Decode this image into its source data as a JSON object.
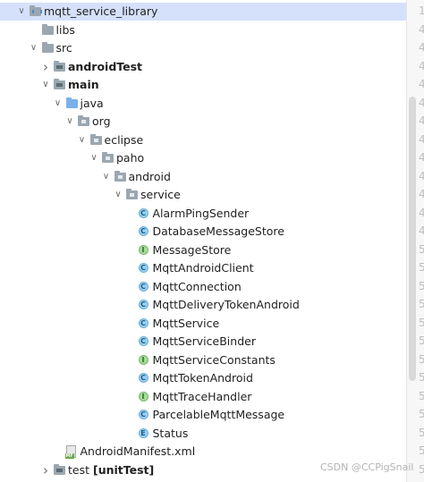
{
  "tree": [
    {
      "label": "mqtt_service_library",
      "suffix": "",
      "depth": 0,
      "arrow": "down",
      "icon": "module-folder-icon",
      "bold": false,
      "selected": true
    },
    {
      "label": "libs",
      "suffix": "",
      "depth": 1,
      "arrow": "none",
      "icon": "folder-icon",
      "bold": false,
      "selected": false
    },
    {
      "label": "src",
      "suffix": "",
      "depth": 1,
      "arrow": "down",
      "icon": "folder-icon",
      "bold": false,
      "selected": false
    },
    {
      "label": "androidTest",
      "suffix": "",
      "depth": 2,
      "arrow": "right",
      "icon": "source-set-folder-icon",
      "bold": true,
      "selected": false
    },
    {
      "label": "main",
      "suffix": "",
      "depth": 2,
      "arrow": "down",
      "icon": "source-set-folder-icon",
      "bold": true,
      "selected": false
    },
    {
      "label": "java",
      "suffix": "",
      "depth": 3,
      "arrow": "down",
      "icon": "source-root-folder-icon",
      "bold": false,
      "selected": false
    },
    {
      "label": "org",
      "suffix": "",
      "depth": 4,
      "arrow": "down",
      "icon": "package-folder-icon",
      "bold": false,
      "selected": false
    },
    {
      "label": "eclipse",
      "suffix": "",
      "depth": 5,
      "arrow": "down",
      "icon": "package-folder-icon",
      "bold": false,
      "selected": false
    },
    {
      "label": "paho",
      "suffix": "",
      "depth": 6,
      "arrow": "down",
      "icon": "package-folder-icon",
      "bold": false,
      "selected": false
    },
    {
      "label": "android",
      "suffix": "",
      "depth": 7,
      "arrow": "down",
      "icon": "package-folder-icon",
      "bold": false,
      "selected": false
    },
    {
      "label": "service",
      "suffix": "",
      "depth": 8,
      "arrow": "down",
      "icon": "package-folder-icon",
      "bold": false,
      "selected": false
    },
    {
      "label": "AlarmPingSender",
      "suffix": "",
      "depth": 9,
      "arrow": "none",
      "icon": "class-icon",
      "bold": false,
      "selected": false
    },
    {
      "label": "DatabaseMessageStore",
      "suffix": "",
      "depth": 9,
      "arrow": "none",
      "icon": "class-icon",
      "bold": false,
      "selected": false
    },
    {
      "label": "MessageStore",
      "suffix": "",
      "depth": 9,
      "arrow": "none",
      "icon": "interface-icon",
      "bold": false,
      "selected": false
    },
    {
      "label": "MqttAndroidClient",
      "suffix": "",
      "depth": 9,
      "arrow": "none",
      "icon": "class-icon",
      "bold": false,
      "selected": false
    },
    {
      "label": "MqttConnection",
      "suffix": "",
      "depth": 9,
      "arrow": "none",
      "icon": "class-icon",
      "bold": false,
      "selected": false
    },
    {
      "label": "MqttDeliveryTokenAndroid",
      "suffix": "",
      "depth": 9,
      "arrow": "none",
      "icon": "class-icon",
      "bold": false,
      "selected": false
    },
    {
      "label": "MqttService",
      "suffix": "",
      "depth": 9,
      "arrow": "none",
      "icon": "class-icon",
      "bold": false,
      "selected": false
    },
    {
      "label": "MqttServiceBinder",
      "suffix": "",
      "depth": 9,
      "arrow": "none",
      "icon": "class-icon",
      "bold": false,
      "selected": false
    },
    {
      "label": "MqttServiceConstants",
      "suffix": "",
      "depth": 9,
      "arrow": "none",
      "icon": "interface-icon",
      "bold": false,
      "selected": false
    },
    {
      "label": "MqttTokenAndroid",
      "suffix": "",
      "depth": 9,
      "arrow": "none",
      "icon": "class-icon",
      "bold": false,
      "selected": false
    },
    {
      "label": "MqttTraceHandler",
      "suffix": "",
      "depth": 9,
      "arrow": "none",
      "icon": "interface-icon",
      "bold": false,
      "selected": false
    },
    {
      "label": "ParcelableMqttMessage",
      "suffix": "",
      "depth": 9,
      "arrow": "none",
      "icon": "class-icon",
      "bold": false,
      "selected": false
    },
    {
      "label": "Status",
      "suffix": "",
      "depth": 9,
      "arrow": "none",
      "icon": "enum-icon",
      "bold": false,
      "selected": false
    },
    {
      "label": "AndroidManifest.xml",
      "suffix": "",
      "depth": 3,
      "arrow": "none",
      "icon": "manifest-file-icon",
      "bold": false,
      "selected": false
    },
    {
      "label": "test",
      "suffix": "[unitTest]",
      "depth": 2,
      "arrow": "right",
      "icon": "source-set-folder-icon",
      "bold": false,
      "selected": false
    }
  ],
  "icon_letters": {
    "class-icon": "C",
    "interface-icon": "I",
    "enum-icon": "E"
  },
  "gutter_numbers": [
    "1",
    "4",
    "4",
    "4",
    "4",
    "4",
    "4",
    "4",
    "4",
    "4",
    "4",
    "4",
    "4",
    "5",
    "5",
    "5",
    "5",
    "5",
    "5",
    "5",
    "5",
    "5",
    "5",
    "5",
    "5",
    "5"
  ],
  "watermark": "CSDN @CCPigSnail",
  "colors": {
    "selection": "#d5e1fb",
    "folder": "#9aa7b0",
    "source_folder": "#79b1ea",
    "class_badge": "#9ad0ef",
    "interface_badge": "#a6d99a"
  }
}
